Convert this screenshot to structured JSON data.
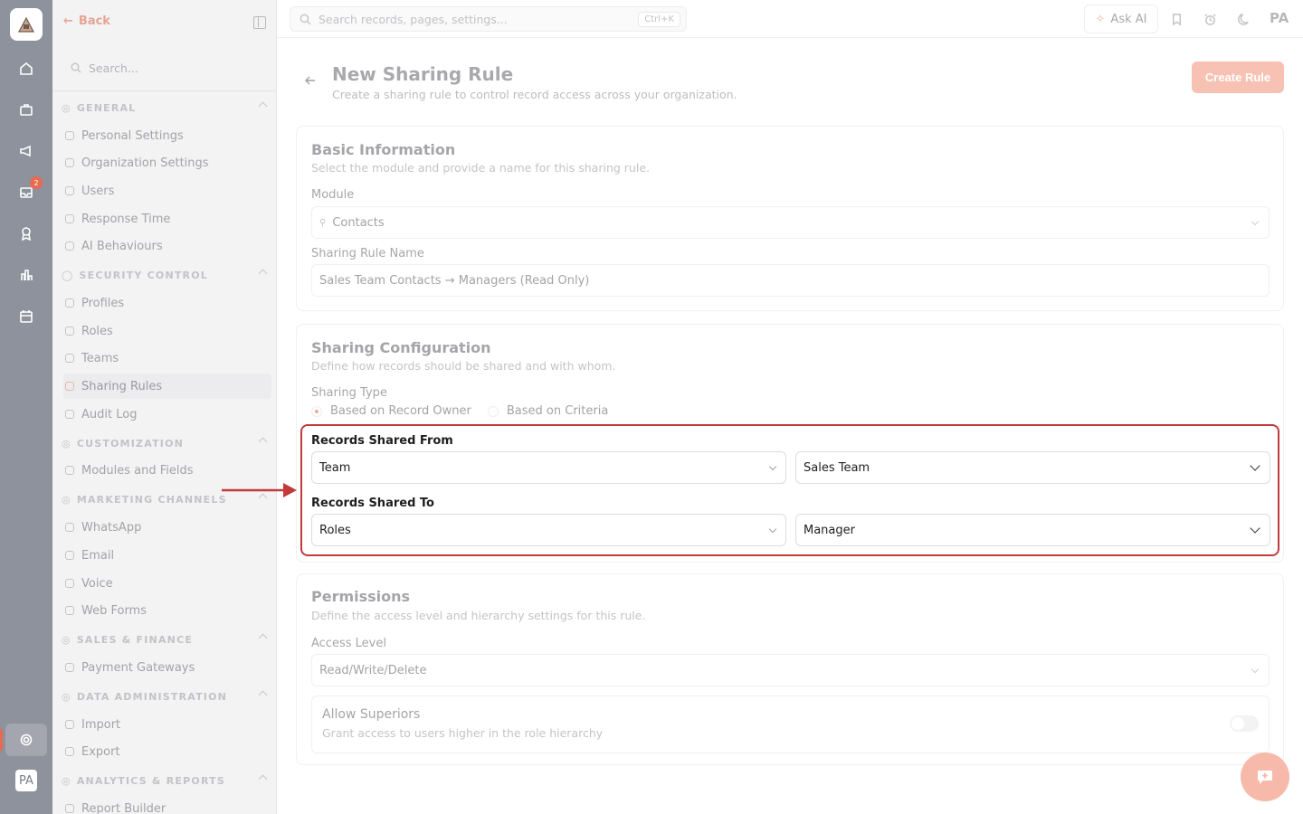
{
  "sidebar": {
    "back_label": "Back",
    "search_placeholder": "Search...",
    "sections": [
      {
        "label": "GENERAL",
        "items": [
          "Personal Settings",
          "Organization Settings",
          "Users",
          "Response Time",
          "AI Behaviours"
        ]
      },
      {
        "label": "SECURITY CONTROL",
        "items": [
          "Profiles",
          "Roles",
          "Teams",
          "Sharing Rules",
          "Audit Log"
        ]
      },
      {
        "label": "CUSTOMIZATION",
        "items": [
          "Modules and Fields"
        ]
      },
      {
        "label": "MARKETING CHANNELS",
        "items": [
          "WhatsApp",
          "Email",
          "Voice",
          "Web Forms"
        ]
      },
      {
        "label": "SALES & FINANCE",
        "items": [
          "Payment Gateways"
        ]
      },
      {
        "label": "DATA ADMINISTRATION",
        "items": [
          "Import",
          "Export"
        ]
      },
      {
        "label": "ANALYTICS & REPORTS",
        "items": [
          "Report Builder"
        ]
      }
    ],
    "active_item": "Sharing Rules"
  },
  "rail": {
    "badge_count": "2",
    "avatar": "PA"
  },
  "topbar": {
    "search_placeholder": "Search records, pages, settings...",
    "shortcut": "Ctrl+K",
    "ask_ai": "Ask AI",
    "avatar": "PA"
  },
  "header": {
    "title": "New Sharing Rule",
    "subtitle": "Create a sharing rule to control record access across your organization.",
    "create_button": "Create Rule"
  },
  "basic_info": {
    "title": "Basic Information",
    "subtitle": "Select the module and provide a name for this sharing rule.",
    "module_label": "Module",
    "module_value": "Contacts",
    "name_label": "Sharing Rule Name",
    "name_value": "Sales Team Contacts → Managers (Read Only)"
  },
  "sharing_config": {
    "title": "Sharing Configuration",
    "subtitle": "Define how records should be shared and with whom.",
    "type_label": "Sharing Type",
    "type_options": [
      "Based on Record Owner",
      "Based on Criteria"
    ],
    "type_selected": "Based on Record Owner",
    "from_label": "Records Shared From",
    "from_type": "Team",
    "from_value": "Sales Team",
    "to_label": "Records Shared To",
    "to_type": "Roles",
    "to_value": "Manager"
  },
  "permissions": {
    "title": "Permissions",
    "subtitle": "Define the access level and hierarchy settings for this rule.",
    "access_label": "Access Level",
    "access_value": "Read/Write/Delete",
    "superiors_title": "Allow Superiors",
    "superiors_sub": "Grant access to users higher in the role hierarchy",
    "superiors_enabled": false
  },
  "colors": {
    "accent": "#e86a52",
    "highlight_border": "#c23a3a",
    "rail": "#8e929c"
  }
}
